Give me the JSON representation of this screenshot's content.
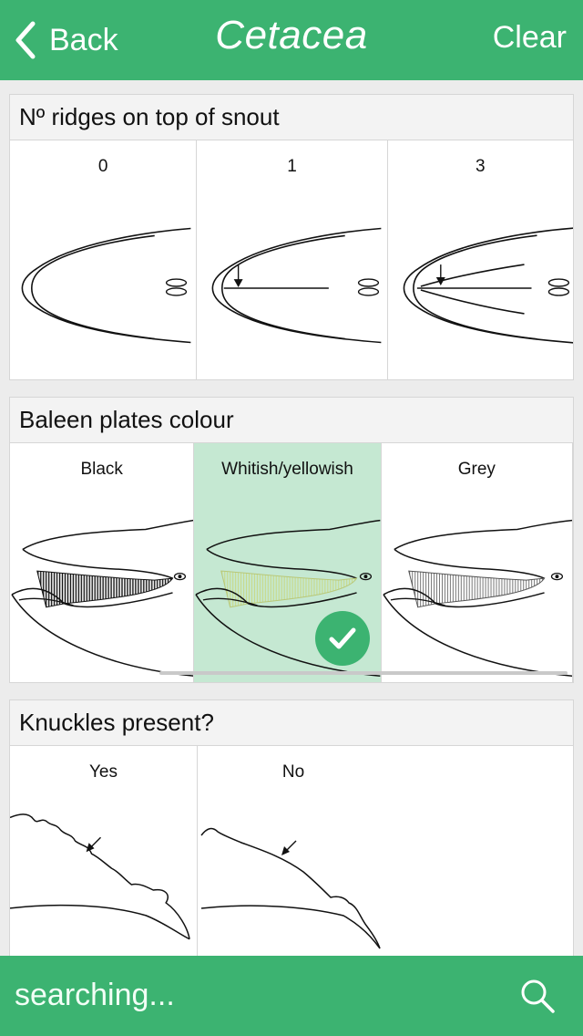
{
  "nav": {
    "back_label": "Back",
    "title": "Cetacea",
    "clear_label": "Clear"
  },
  "sections": [
    {
      "title": "Nº ridges on top of snout",
      "options": [
        {
          "label": "0"
        },
        {
          "label": "1"
        },
        {
          "label": "3"
        }
      ]
    },
    {
      "title": "Baleen plates colour",
      "options": [
        {
          "label": "Black"
        },
        {
          "label": "Whitish/yellowish",
          "selected": true
        },
        {
          "label": "Grey"
        }
      ]
    },
    {
      "title": "Knuckles present?",
      "options": [
        {
          "label": "Yes"
        },
        {
          "label": "No"
        }
      ]
    }
  ],
  "search": {
    "text": "searching...",
    "icon": "search-icon"
  },
  "colors": {
    "accent": "#3cb371",
    "selected_bg": "#c5e8d2"
  }
}
